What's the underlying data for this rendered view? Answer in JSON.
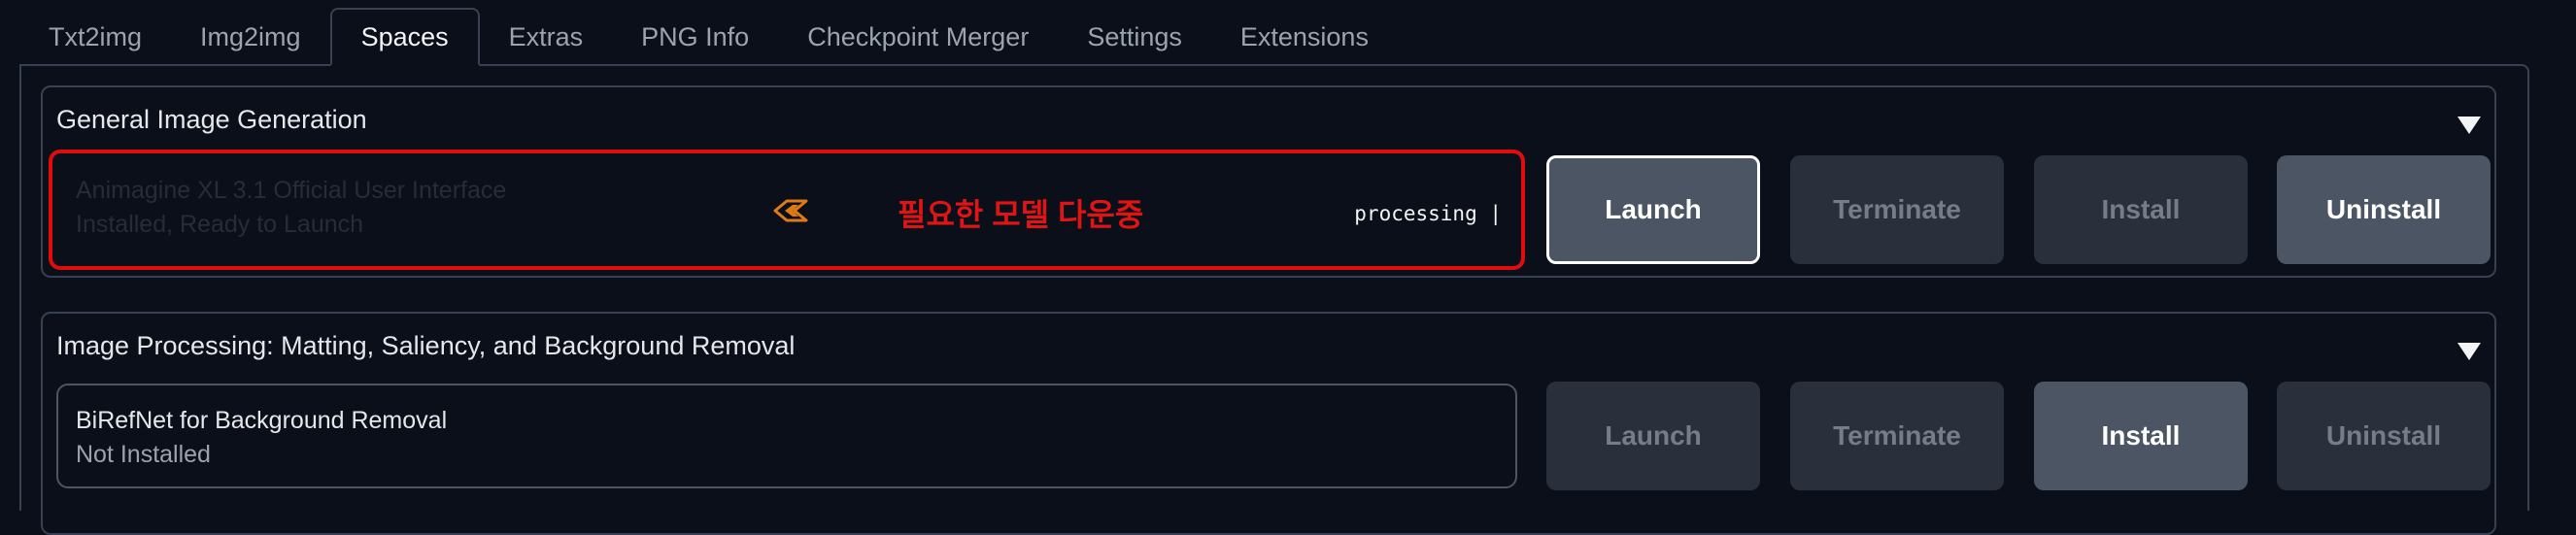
{
  "tabs": [
    {
      "label": "Txt2img",
      "active": false
    },
    {
      "label": "Img2img",
      "active": false
    },
    {
      "label": "Spaces",
      "active": true
    },
    {
      "label": "Extras",
      "active": false
    },
    {
      "label": "PNG Info",
      "active": false
    },
    {
      "label": "Checkpoint Merger",
      "active": false
    },
    {
      "label": "Settings",
      "active": false
    },
    {
      "label": "Extensions",
      "active": false
    }
  ],
  "groups": [
    {
      "title": "General Image Generation",
      "space": {
        "name": "Animagine XL 3.1 Official User Interface",
        "status": "Installed, Ready to Launch",
        "progress_message": "필요한 모델 다운중",
        "progress_text": "processing |",
        "spinner_icon": "loading-spinner-icon"
      },
      "buttons": {
        "launch": "Launch",
        "terminate": "Terminate",
        "install": "Install",
        "uninstall": "Uninstall"
      }
    },
    {
      "title": "Image Processing: Matting, Saliency, and Background Removal",
      "space": {
        "name": "BiRefNet for Background Removal",
        "status": "Not Installed"
      },
      "buttons": {
        "launch": "Launch",
        "terminate": "Terminate",
        "install": "Install",
        "uninstall": "Uninstall"
      }
    }
  ],
  "colors": {
    "background": "#0b0f19",
    "highlight_border": "#e00d0d",
    "korean_text": "#e01414",
    "spinner": "#e07b14",
    "button_enabled": "#4b5563",
    "button_disabled": "#2a303b"
  }
}
